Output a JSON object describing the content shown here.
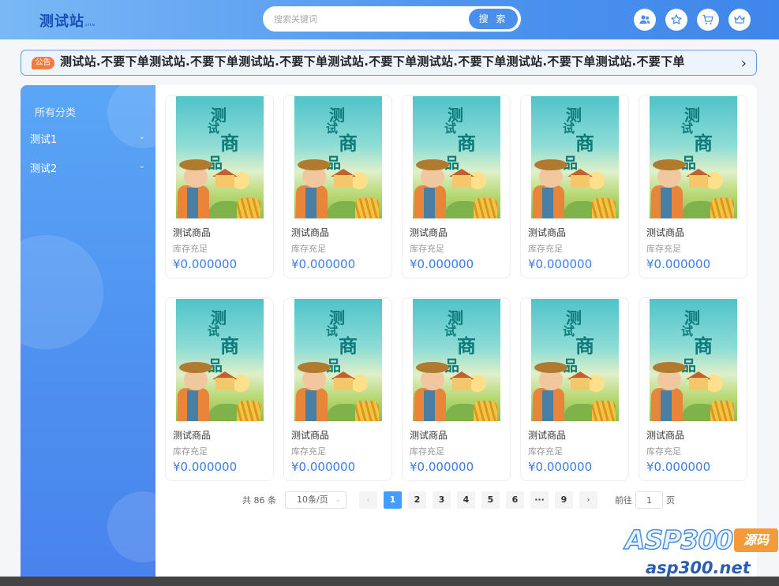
{
  "header": {
    "logo": "测试站",
    "logo_sub": "site",
    "search_placeholder": "搜索关键词",
    "search_button": "搜 索",
    "icons": [
      "user-group-icon",
      "star-icon",
      "cart-icon",
      "crown-icon"
    ]
  },
  "notice": {
    "badge": "公告",
    "text": "测试站.不要下单测试站.不要下单测试站.不要下单测试站.不要下单测试站.不要下单测试站.不要下单测试站.不要下单"
  },
  "sidebar": {
    "title": "所有分类",
    "items": [
      {
        "label": "测试1"
      },
      {
        "label": "测试2"
      }
    ]
  },
  "products": [
    {
      "name": "测试商品",
      "stock": "库存充足",
      "price": "¥0.000000"
    },
    {
      "name": "测试商品",
      "stock": "库存充足",
      "price": "¥0.000000"
    },
    {
      "name": "测试商品",
      "stock": "库存充足",
      "price": "¥0.000000"
    },
    {
      "name": "测试商品",
      "stock": "库存充足",
      "price": "¥0.000000"
    },
    {
      "name": "测试商品",
      "stock": "库存充足",
      "price": "¥0.000000"
    },
    {
      "name": "测试商品",
      "stock": "库存充足",
      "price": "¥0.000000"
    },
    {
      "name": "测试商品",
      "stock": "库存充足",
      "price": "¥0.000000"
    },
    {
      "name": "测试商品",
      "stock": "库存充足",
      "price": "¥0.000000"
    },
    {
      "name": "测试商品",
      "stock": "库存充足",
      "price": "¥0.000000"
    },
    {
      "name": "测试商品",
      "stock": "库存充足",
      "price": "¥0.000000"
    }
  ],
  "thumb_text": [
    "测",
    "试",
    "商",
    "品"
  ],
  "pagination": {
    "total": "共 86 条",
    "page_size": "10条/页",
    "pages": [
      "1",
      "2",
      "3",
      "4",
      "5",
      "6",
      "···",
      "9"
    ],
    "active_page": "1",
    "goto_label": "前往",
    "goto_value": "1",
    "page_suffix": "页"
  },
  "watermark": {
    "brand": "ASP300",
    "tag": "源码",
    "url": "asp300.net"
  },
  "colors": {
    "accent": "#409eff",
    "price": "#3d7ee8",
    "notice_badge": "#f47b3d"
  }
}
